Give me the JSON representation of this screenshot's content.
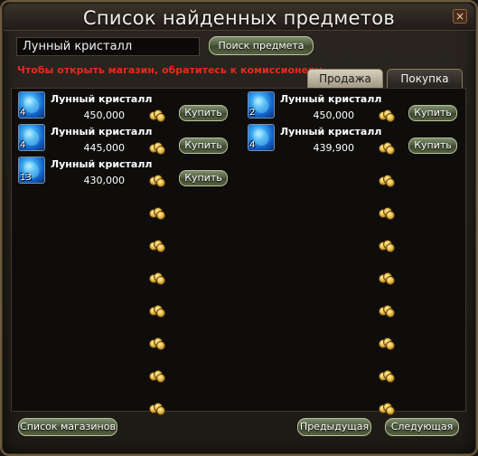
{
  "window": {
    "title": "Список найденных предметов",
    "close_label": "×"
  },
  "search": {
    "value": "Лунный кристалл",
    "button_label": "Поиск предмета"
  },
  "notice": "Чтобы открыть магазин, обратитесь к комиссионеру.",
  "tabs": [
    {
      "label": "Продажа",
      "active": true
    },
    {
      "label": "Покупка",
      "active": false
    }
  ],
  "buy_label": "Купить",
  "listings": [
    {
      "name": "Лунный кристалл",
      "qty": "4",
      "price": "450,000"
    },
    {
      "name": "Лунный кристалл",
      "qty": "2",
      "price": "450,000"
    },
    {
      "name": "Лунный кристалл",
      "qty": "4",
      "price": "445,000"
    },
    {
      "name": "Лунный кристалл",
      "qty": "4",
      "price": "439,900"
    },
    {
      "name": "Лунный кристалл",
      "qty": "13",
      "price": "430,000"
    }
  ],
  "footer": {
    "shops_label": "Список магазинов",
    "prev_label": "Предыдущая",
    "next_label": "Следующая"
  },
  "colors": {
    "notice_red": "#e72a1e",
    "button_green": "#55623f",
    "crystal_blue": "#3aa9f2",
    "adena_gold": "#e3b23c"
  },
  "icons": {
    "item": "moon-crystal-icon",
    "currency": "adena-icon",
    "close": "close-icon"
  }
}
